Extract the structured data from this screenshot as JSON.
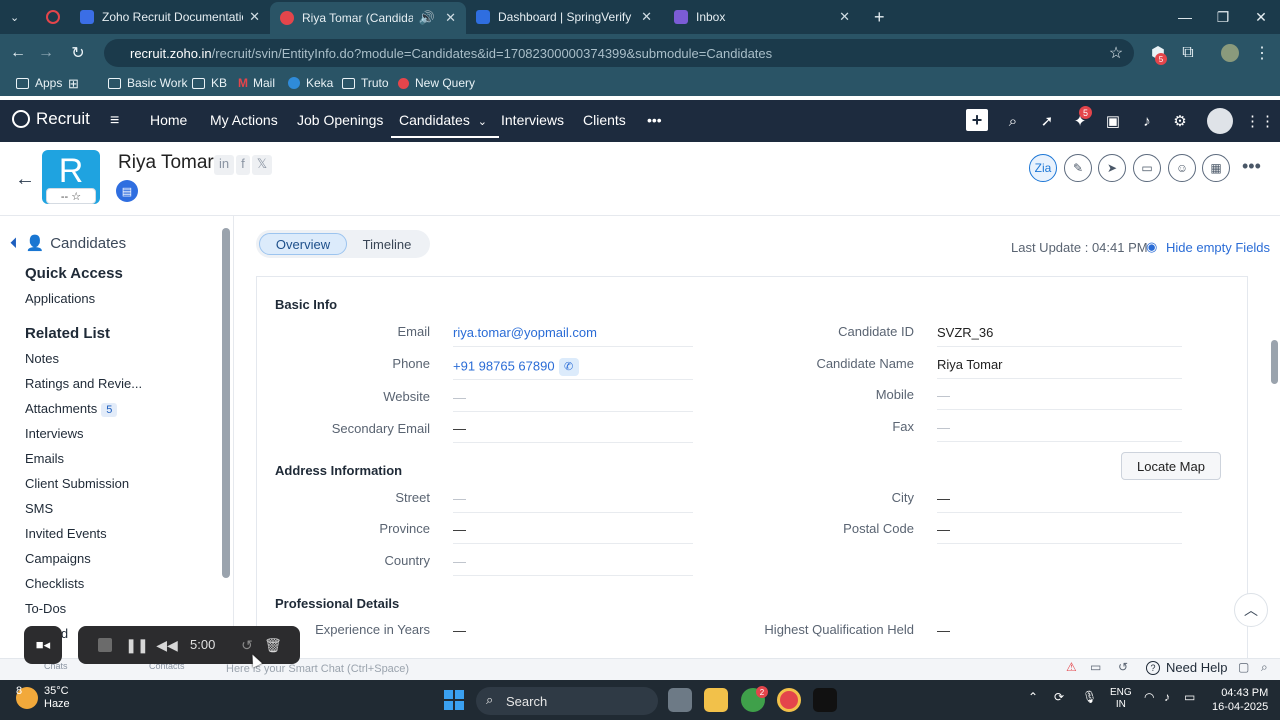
{
  "browser": {
    "tabs": [
      {
        "title": "Zoho Recruit Documentation - ",
        "favicon_color": "#3b6ee6"
      },
      {
        "title": "Riya Tomar (Candidate) - S",
        "favicon_color": "#e4454b"
      },
      {
        "title": "Dashboard | SpringVerify",
        "favicon_color": "#2f6ee0"
      },
      {
        "title": "Inbox",
        "favicon_color": "#7b5cd6"
      }
    ],
    "url_host": "recruit.zoho.in",
    "url_path": "/recruit/svin/EntityInfo.do?module=Candidates&id=17082300000374399&submodule=Candidates",
    "bookmarks": [
      "Apps",
      "Basic Work",
      "KB",
      "Mail",
      "Keka",
      "Truto",
      "New Query"
    ],
    "extension_badge": "5"
  },
  "app": {
    "logo": "Recruit",
    "nav": [
      "Home",
      "My Actions",
      "Job Openings",
      "Candidates",
      "Interviews",
      "Clients"
    ],
    "notif_count": "5"
  },
  "record": {
    "initial": "R",
    "name": "Riya Tomar",
    "rating": "-- ☆",
    "social": [
      "in",
      "f",
      "𝕏"
    ]
  },
  "left_panel": {
    "header": "Candidates",
    "quick_access_title": "Quick Access",
    "quick_access": [
      "Applications"
    ],
    "related_title": "Related List",
    "related": [
      {
        "label": "Notes"
      },
      {
        "label": "Ratings and Revie..."
      },
      {
        "label": "Attachments",
        "count": "5"
      },
      {
        "label": "Interviews"
      },
      {
        "label": "Emails"
      },
      {
        "label": "Client Submission"
      },
      {
        "label": "SMS"
      },
      {
        "label": "Invited Events"
      },
      {
        "label": "Campaigns"
      },
      {
        "label": "Checklists"
      },
      {
        "label": "To-Dos"
      },
      {
        "label": "Offered"
      }
    ]
  },
  "main": {
    "tabs": [
      "Overview",
      "Timeline"
    ],
    "last_update": "Last Update : 04:41 PM",
    "hide_empty": "Hide empty Fields",
    "basic_info": {
      "title": "Basic Info",
      "email_label": "Email",
      "email": "riya.tomar@yopmail.com",
      "phone_label": "Phone",
      "phone": "+91 98765 67890",
      "website_label": "Website",
      "website": "—",
      "secondary_email_label": "Secondary Email",
      "secondary_email": "—",
      "candidate_id_label": "Candidate ID",
      "candidate_id": "SVZR_36",
      "candidate_name_label": "Candidate Name",
      "candidate_name": "Riya Tomar",
      "mobile_label": "Mobile",
      "mobile": "—",
      "fax_label": "Fax",
      "fax": "—"
    },
    "address": {
      "title": "Address Information",
      "locate_map": "Locate Map",
      "street_label": "Street",
      "street": "—",
      "province_label": "Province",
      "province": "—",
      "country_label": "Country",
      "country": "—",
      "city_label": "City",
      "city": "—",
      "postal_label": "Postal Code",
      "postal": "—"
    },
    "professional": {
      "title": "Professional Details",
      "experience_label": "Experience in Years",
      "experience": "—",
      "qualification_label": "Highest Qualification Held",
      "qualification": "—"
    }
  },
  "bottom": {
    "chat_placeholder": "Here is your Smart Chat (Ctrl+Space)",
    "need_help": "Need Help",
    "chats": "Chats",
    "contacts": "Contacts"
  },
  "recorder": {
    "time": "5:00"
  },
  "taskbar": {
    "temp": "35°C",
    "weather": "Haze",
    "weather_badge": "8",
    "search": "Search",
    "lang_1": "ENG",
    "lang_2": "IN",
    "time": "04:43 PM",
    "date": "16-04-2025",
    "app_badge": "2"
  }
}
